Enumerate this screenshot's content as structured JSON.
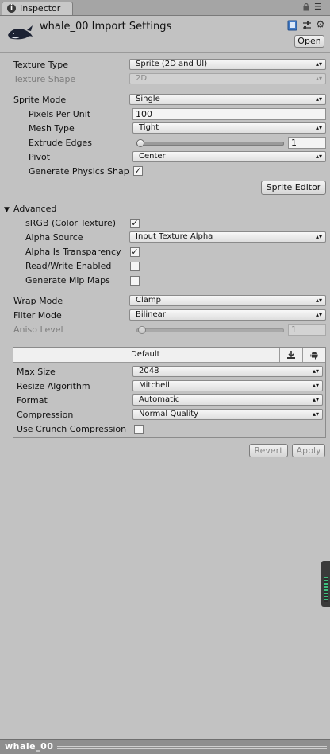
{
  "window": {
    "tab_label": "Inspector",
    "tab_icon": "info-icon"
  },
  "header": {
    "title": "whale_00 Import Settings",
    "asset_icon": "whale-sprite-icon",
    "open_label": "Open"
  },
  "texture": {
    "type_label": "Texture Type",
    "type_value": "Sprite (2D and UI)",
    "shape_label": "Texture Shape",
    "shape_value": "2D"
  },
  "sprite": {
    "mode_label": "Sprite Mode",
    "mode_value": "Single",
    "ppu_label": "Pixels Per Unit",
    "ppu_value": "100",
    "mesh_label": "Mesh Type",
    "mesh_value": "Tight",
    "extrude_label": "Extrude Edges",
    "extrude_value": "1",
    "pivot_label": "Pivot",
    "pivot_value": "Center",
    "physics_label": "Generate Physics Shap",
    "editor_button": "Sprite Editor"
  },
  "advanced": {
    "header": "Advanced",
    "srgb_label": "sRGB (Color Texture)",
    "alpha_source_label": "Alpha Source",
    "alpha_source_value": "Input Texture Alpha",
    "alpha_transparency_label": "Alpha Is Transparency",
    "rw_label": "Read/Write Enabled",
    "mip_label": "Generate Mip Maps"
  },
  "sampling": {
    "wrap_label": "Wrap Mode",
    "wrap_value": "Clamp",
    "filter_label": "Filter Mode",
    "filter_value": "Bilinear",
    "aniso_label": "Aniso Level",
    "aniso_value": "1"
  },
  "platform": {
    "default_tab": "Default",
    "max_size_label": "Max Size",
    "max_size_value": "2048",
    "resize_label": "Resize Algorithm",
    "resize_value": "Mitchell",
    "format_label": "Format",
    "format_value": "Automatic",
    "compression_label": "Compression",
    "compression_value": "Normal Quality",
    "crunch_label": "Use Crunch Compression"
  },
  "actions": {
    "revert": "Revert",
    "apply": "Apply"
  },
  "status": {
    "asset_name": "whale_00"
  },
  "checks": {
    "physics": true,
    "srgb": true,
    "alpha_transparency": true,
    "rw": false,
    "mip": false,
    "crunch": false
  }
}
